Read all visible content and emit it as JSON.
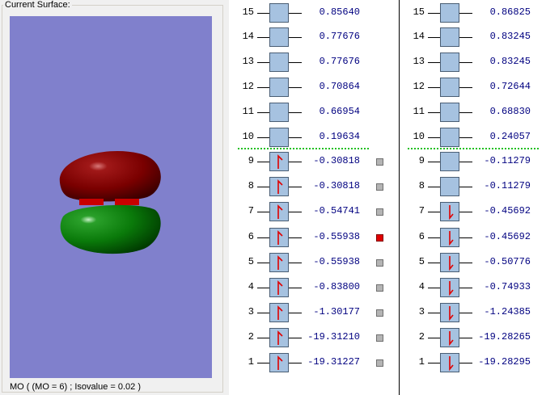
{
  "surface_panel": {
    "group_title": "Current Surface:",
    "status": "MO ( (MO = 6) ; Isovalue = 0.02 )"
  },
  "colors": {
    "viewport_bg": "#8080cc",
    "positive_lobe": "#8b0000",
    "negative_lobe": "#006400",
    "occupied_arrow": "#e00000",
    "homo_lumo_divider": "#20c020",
    "selected_orbital": "#e00000"
  },
  "alpha": {
    "rows": [
      {
        "n": "15",
        "energy": "0.85640",
        "occupied": false,
        "spin": "none",
        "selected": null
      },
      {
        "n": "14",
        "energy": "0.77676",
        "occupied": false,
        "spin": "none",
        "selected": null
      },
      {
        "n": "13",
        "energy": "0.77676",
        "occupied": false,
        "spin": "none",
        "selected": null
      },
      {
        "n": "12",
        "energy": "0.70864",
        "occupied": false,
        "spin": "none",
        "selected": null
      },
      {
        "n": "11",
        "energy": "0.66954",
        "occupied": false,
        "spin": "none",
        "selected": null
      },
      {
        "n": "10",
        "energy": "0.19634",
        "occupied": false,
        "spin": "none",
        "selected": null
      },
      {
        "n": "9",
        "energy": "-0.30818",
        "occupied": true,
        "spin": "up",
        "selected": false
      },
      {
        "n": "8",
        "energy": "-0.30818",
        "occupied": true,
        "spin": "up",
        "selected": false
      },
      {
        "n": "7",
        "energy": "-0.54741",
        "occupied": true,
        "spin": "up",
        "selected": false
      },
      {
        "n": "6",
        "energy": "-0.55938",
        "occupied": true,
        "spin": "up",
        "selected": true
      },
      {
        "n": "5",
        "energy": "-0.55938",
        "occupied": true,
        "spin": "up",
        "selected": false
      },
      {
        "n": "4",
        "energy": "-0.83800",
        "occupied": true,
        "spin": "up",
        "selected": false
      },
      {
        "n": "3",
        "energy": "-1.30177",
        "occupied": true,
        "spin": "up",
        "selected": false
      },
      {
        "n": "2",
        "energy": "-19.31210",
        "occupied": true,
        "spin": "up",
        "selected": false
      },
      {
        "n": "1",
        "energy": "-19.31227",
        "occupied": true,
        "spin": "up",
        "selected": false
      }
    ]
  },
  "beta": {
    "rows": [
      {
        "n": "15",
        "energy": "0.86825",
        "occupied": false,
        "spin": "none"
      },
      {
        "n": "14",
        "energy": "0.83245",
        "occupied": false,
        "spin": "none"
      },
      {
        "n": "13",
        "energy": "0.83245",
        "occupied": false,
        "spin": "none"
      },
      {
        "n": "12",
        "energy": "0.72644",
        "occupied": false,
        "spin": "none"
      },
      {
        "n": "11",
        "energy": "0.68830",
        "occupied": false,
        "spin": "none"
      },
      {
        "n": "10",
        "energy": "0.24057",
        "occupied": false,
        "spin": "none"
      },
      {
        "n": "9",
        "energy": "-0.11279",
        "occupied": false,
        "spin": "none"
      },
      {
        "n": "8",
        "energy": "-0.11279",
        "occupied": false,
        "spin": "none"
      },
      {
        "n": "7",
        "energy": "-0.45692",
        "occupied": true,
        "spin": "down"
      },
      {
        "n": "6",
        "energy": "-0.45692",
        "occupied": true,
        "spin": "down"
      },
      {
        "n": "5",
        "energy": "-0.50776",
        "occupied": true,
        "spin": "down"
      },
      {
        "n": "4",
        "energy": "-0.74933",
        "occupied": true,
        "spin": "down"
      },
      {
        "n": "3",
        "energy": "-1.24385",
        "occupied": true,
        "spin": "down"
      },
      {
        "n": "2",
        "energy": "-19.28265",
        "occupied": true,
        "spin": "down"
      },
      {
        "n": "1",
        "energy": "-19.28295",
        "occupied": true,
        "spin": "down"
      }
    ]
  }
}
